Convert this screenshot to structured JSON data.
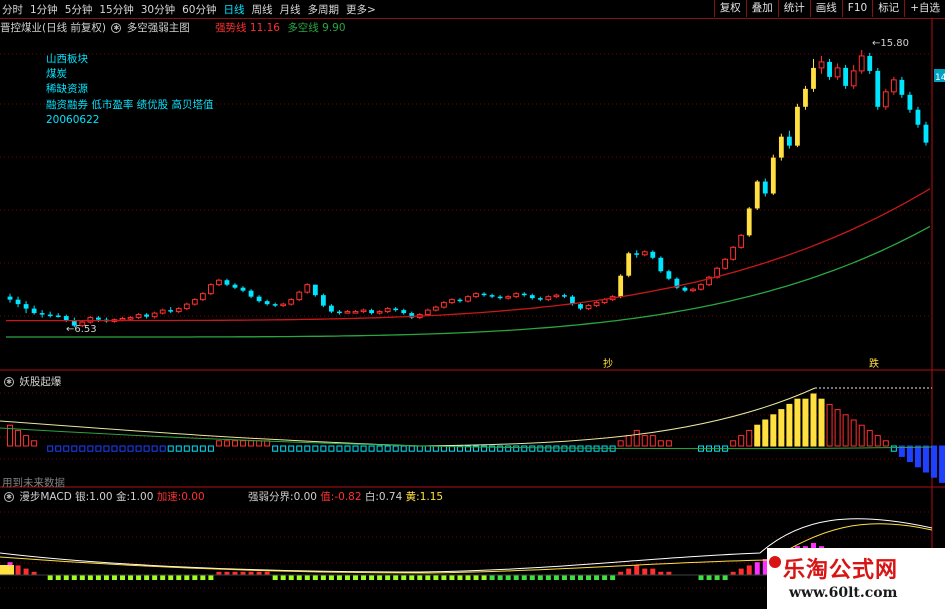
{
  "toolbar": {
    "periods": [
      "分时",
      "1分钟",
      "5分钟",
      "15分钟",
      "30分钟",
      "60分钟",
      "日线",
      "周线",
      "月线",
      "多周期",
      "更多>"
    ],
    "active_period": "日线",
    "right_buttons": [
      "复权",
      "叠加",
      "统计",
      "画线",
      "F10",
      "标记",
      "+自选"
    ]
  },
  "main_panel": {
    "stock_name": "晋控煤业(日线 前复权)",
    "indicator": "多空强弱主图",
    "strong_label": "强势线",
    "strong_value": "11.16",
    "longshort_label": "多空线",
    "longshort_value": "9.90",
    "info_lines": [
      "山西板块",
      "煤炭",
      "稀缺资源",
      "融资融券 低市盈率 绩优股 高贝塔值",
      "20060622"
    ],
    "high_label": "15.80",
    "low_label": "6.53",
    "right_edge_label": "14",
    "signal_buy": "抄",
    "signal_sell": "跌"
  },
  "mid_panel": {
    "title": "妖股起爆",
    "note": "用到未来数据"
  },
  "macd_panel": {
    "title": "漫步MACD",
    "silver_label": "银:",
    "silver_value": "1.00",
    "gold_label": "金:",
    "gold_value": "1.00",
    "speedup_label": "加速:",
    "speedup_value": "0.00",
    "boundary_label": "强弱分界:",
    "boundary_value": "0.00",
    "blue_label": "值:",
    "blue_value": "-0.82",
    "white_label": "白:",
    "white_value": "0.74",
    "yellow_label": "黄:",
    "yellow_value": "1.15"
  },
  "colors": {
    "up": "#ff3030",
    "down": "#00e5ff",
    "yellow": "#ffe040",
    "red_line": "#c81818",
    "green_line": "#2aa640",
    "grid": "#7a0000",
    "blue": "#2040ff",
    "magenta": "#ff30ff"
  },
  "chart_data": {
    "type": "candlestick",
    "y_range_price": [
      6.0,
      16.2
    ],
    "candles": [
      [
        7.55,
        7.45,
        7.65,
        7.35
      ],
      [
        7.45,
        7.3,
        7.55,
        7.2
      ],
      [
        7.3,
        7.15,
        7.4,
        7.0
      ],
      [
        7.15,
        7.0,
        7.25,
        6.95
      ],
      [
        7.0,
        6.95,
        7.1,
        6.85
      ],
      [
        6.95,
        6.92,
        7.05,
        6.85
      ],
      [
        6.92,
        6.9,
        7.0,
        6.85
      ],
      [
        6.9,
        6.75,
        6.95,
        6.7
      ],
      [
        6.75,
        6.58,
        6.85,
        6.53
      ],
      [
        6.58,
        6.7,
        6.75,
        6.53
      ],
      [
        6.7,
        6.85,
        6.9,
        6.65
      ],
      [
        6.85,
        6.78,
        6.9,
        6.7
      ],
      [
        6.78,
        6.72,
        6.85,
        6.68
      ],
      [
        6.72,
        6.78,
        6.82,
        6.68
      ],
      [
        6.78,
        6.82,
        6.88,
        6.72
      ],
      [
        6.82,
        6.85,
        6.9,
        6.75
      ],
      [
        6.85,
        6.95,
        7.0,
        6.8
      ],
      [
        6.95,
        6.88,
        7.0,
        6.82
      ],
      [
        6.88,
        7.0,
        7.05,
        6.82
      ],
      [
        7.0,
        7.1,
        7.15,
        6.95
      ],
      [
        7.1,
        7.05,
        7.2,
        7.0
      ],
      [
        7.05,
        7.15,
        7.2,
        7.0
      ],
      [
        7.15,
        7.3,
        7.35,
        7.1
      ],
      [
        7.3,
        7.45,
        7.5,
        7.25
      ],
      [
        7.45,
        7.65,
        7.7,
        7.4
      ],
      [
        7.65,
        7.95,
        8.0,
        7.6
      ],
      [
        7.95,
        8.1,
        8.15,
        7.9
      ],
      [
        8.1,
        7.95,
        8.15,
        7.9
      ],
      [
        7.95,
        7.85,
        8.0,
        7.8
      ],
      [
        7.85,
        7.75,
        7.9,
        7.7
      ],
      [
        7.75,
        7.55,
        7.8,
        7.5
      ],
      [
        7.55,
        7.4,
        7.6,
        7.35
      ],
      [
        7.4,
        7.3,
        7.45,
        7.25
      ],
      [
        7.3,
        7.25,
        7.35,
        7.2
      ],
      [
        7.25,
        7.3,
        7.35,
        7.2
      ],
      [
        7.3,
        7.45,
        7.5,
        7.25
      ],
      [
        7.45,
        7.7,
        7.75,
        7.4
      ],
      [
        7.7,
        7.95,
        8.0,
        7.65
      ],
      [
        7.95,
        7.6,
        7.95,
        7.55
      ],
      [
        7.6,
        7.25,
        7.65,
        7.2
      ],
      [
        7.25,
        7.05,
        7.3,
        7.0
      ],
      [
        7.05,
        7.0,
        7.1,
        6.95
      ],
      [
        7.0,
        7.05,
        7.1,
        6.98
      ],
      [
        7.05,
        7.05,
        7.1,
        7.0
      ],
      [
        7.05,
        7.1,
        7.15,
        7.0
      ],
      [
        7.1,
        7.0,
        7.15,
        6.95
      ],
      [
        7.0,
        7.05,
        7.1,
        6.95
      ],
      [
        7.05,
        7.15,
        7.2,
        7.0
      ],
      [
        7.15,
        7.1,
        7.2,
        7.05
      ],
      [
        7.1,
        7.0,
        7.15,
        6.95
      ],
      [
        7.0,
        6.85,
        7.05,
        6.8
      ],
      [
        6.85,
        6.95,
        7.0,
        6.8
      ],
      [
        6.95,
        7.1,
        7.15,
        6.9
      ],
      [
        7.1,
        7.2,
        7.25,
        7.05
      ],
      [
        7.2,
        7.35,
        7.4,
        7.15
      ],
      [
        7.35,
        7.45,
        7.5,
        7.3
      ],
      [
        7.45,
        7.4,
        7.5,
        7.35
      ],
      [
        7.4,
        7.55,
        7.6,
        7.35
      ],
      [
        7.55,
        7.65,
        7.7,
        7.5
      ],
      [
        7.65,
        7.6,
        7.7,
        7.55
      ],
      [
        7.6,
        7.55,
        7.65,
        7.5
      ],
      [
        7.55,
        7.5,
        7.6,
        7.45
      ],
      [
        7.5,
        7.55,
        7.6,
        7.45
      ],
      [
        7.55,
        7.65,
        7.7,
        7.5
      ],
      [
        7.65,
        7.6,
        7.7,
        7.55
      ],
      [
        7.6,
        7.5,
        7.65,
        7.45
      ],
      [
        7.5,
        7.45,
        7.55,
        7.4
      ],
      [
        7.45,
        7.55,
        7.6,
        7.4
      ],
      [
        7.55,
        7.6,
        7.65,
        7.5
      ],
      [
        7.6,
        7.55,
        7.65,
        7.5
      ],
      [
        7.55,
        7.3,
        7.6,
        7.25
      ],
      [
        7.3,
        7.15,
        7.35,
        7.1
      ],
      [
        7.15,
        7.25,
        7.3,
        7.1
      ],
      [
        7.25,
        7.35,
        7.4,
        7.2
      ],
      [
        7.35,
        7.45,
        7.5,
        7.3
      ],
      [
        7.45,
        7.55,
        7.6,
        7.4
      ],
      [
        7.55,
        8.25,
        8.3,
        7.5
      ],
      [
        8.25,
        9.0,
        9.05,
        8.2
      ],
      [
        9.0,
        8.95,
        9.1,
        8.85
      ],
      [
        8.95,
        9.05,
        9.1,
        8.9
      ],
      [
        9.05,
        8.85,
        9.1,
        8.8
      ],
      [
        8.85,
        8.4,
        8.9,
        8.35
      ],
      [
        8.4,
        8.15,
        8.45,
        8.1
      ],
      [
        8.15,
        7.85,
        8.2,
        7.8
      ],
      [
        7.85,
        7.75,
        7.9,
        7.7
      ],
      [
        7.75,
        7.8,
        7.85,
        7.7
      ],
      [
        7.8,
        7.95,
        8.0,
        7.75
      ],
      [
        7.95,
        8.2,
        8.25,
        7.9
      ],
      [
        8.2,
        8.5,
        8.55,
        8.15
      ],
      [
        8.5,
        8.8,
        8.85,
        8.45
      ],
      [
        8.8,
        9.2,
        9.25,
        8.75
      ],
      [
        9.2,
        9.6,
        9.65,
        9.15
      ],
      [
        9.6,
        10.5,
        10.55,
        9.55
      ],
      [
        10.5,
        11.4,
        11.45,
        10.45
      ],
      [
        11.4,
        11.0,
        11.5,
        10.9
      ],
      [
        11.0,
        12.2,
        12.3,
        10.95
      ],
      [
        12.2,
        12.9,
        13.0,
        12.1
      ],
      [
        12.9,
        12.6,
        13.1,
        12.5
      ],
      [
        12.6,
        13.9,
        14.0,
        12.55
      ],
      [
        13.9,
        14.5,
        14.6,
        13.8
      ],
      [
        14.5,
        15.2,
        15.5,
        14.4
      ],
      [
        15.2,
        15.4,
        15.6,
        15.0
      ],
      [
        15.4,
        14.9,
        15.5,
        14.8
      ],
      [
        14.9,
        15.2,
        15.35,
        14.8
      ],
      [
        15.2,
        14.6,
        15.3,
        14.5
      ],
      [
        14.6,
        15.1,
        15.3,
        14.5
      ],
      [
        15.1,
        15.6,
        15.8,
        15.0
      ],
      [
        15.6,
        15.1,
        15.7,
        15.0
      ],
      [
        15.1,
        13.9,
        15.2,
        13.8
      ],
      [
        13.9,
        14.4,
        14.5,
        13.8
      ],
      [
        14.4,
        14.8,
        14.9,
        14.3
      ],
      [
        14.8,
        14.3,
        14.9,
        14.2
      ],
      [
        14.3,
        13.8,
        14.4,
        13.7
      ],
      [
        13.8,
        13.3,
        13.9,
        13.2
      ],
      [
        13.3,
        12.7,
        13.4,
        12.6
      ]
    ],
    "ma_red_ends": [
      6.75,
      11.16
    ],
    "ma_green_ends": [
      6.2,
      9.9
    ],
    "histogram": [
      4,
      3,
      2,
      1,
      0,
      -1,
      -1,
      -1,
      -1,
      -1,
      -1,
      -1,
      -1,
      -1,
      -1,
      -1,
      -1,
      -1,
      -1,
      -1,
      -1,
      -1,
      -1,
      -1,
      -1,
      -1,
      1,
      1,
      1,
      1,
      1,
      1,
      1,
      -1,
      -1,
      -1,
      -1,
      -1,
      -1,
      -1,
      -1,
      -1,
      -1,
      -1,
      -1,
      -1,
      -1,
      -1,
      -1,
      -1,
      -1,
      -1,
      -1,
      -1,
      -1,
      -1,
      -1,
      -1,
      -1,
      -1,
      -1,
      -1,
      -1,
      -1,
      -1,
      -1,
      -1,
      -1,
      -1,
      -1,
      -1,
      -1,
      -1,
      -1,
      -1,
      -1,
      1,
      2,
      3,
      2,
      2,
      1,
      1,
      0,
      0,
      0,
      -1,
      -1,
      -1,
      -1,
      1,
      2,
      3,
      4,
      5,
      6,
      7,
      8,
      9,
      9,
      10,
      9,
      8,
      7,
      6,
      5,
      4,
      3,
      2,
      1,
      -1,
      -2,
      -3,
      -4,
      -5,
      -6,
      -7
    ]
  }
}
